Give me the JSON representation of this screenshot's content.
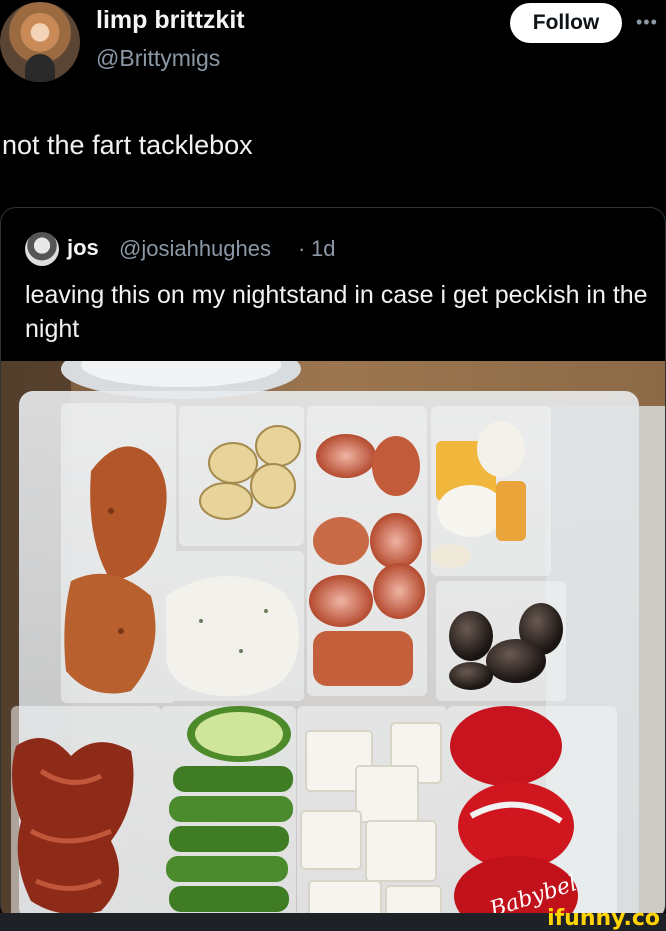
{
  "post": {
    "display_name": "limp brittzkit",
    "handle": "@Brittymigs",
    "follow_label": "Follow",
    "more_icon": "more-dots-icon",
    "text": "not the fart tacklebox"
  },
  "quoted": {
    "display_name": "jos",
    "handle": "@josiahhughes",
    "separator": "·",
    "time": "1d",
    "text": "leaving this on my nightstand in case i get peckish in the night",
    "photo_brand_text": "Babybel"
  },
  "watermark": "ifunny.co",
  "colors": {
    "background": "#000000",
    "text": "#e7e9ea",
    "muted": "#8b98a5",
    "follow_bg": "#ffffff",
    "watermark": "#ffd400"
  }
}
